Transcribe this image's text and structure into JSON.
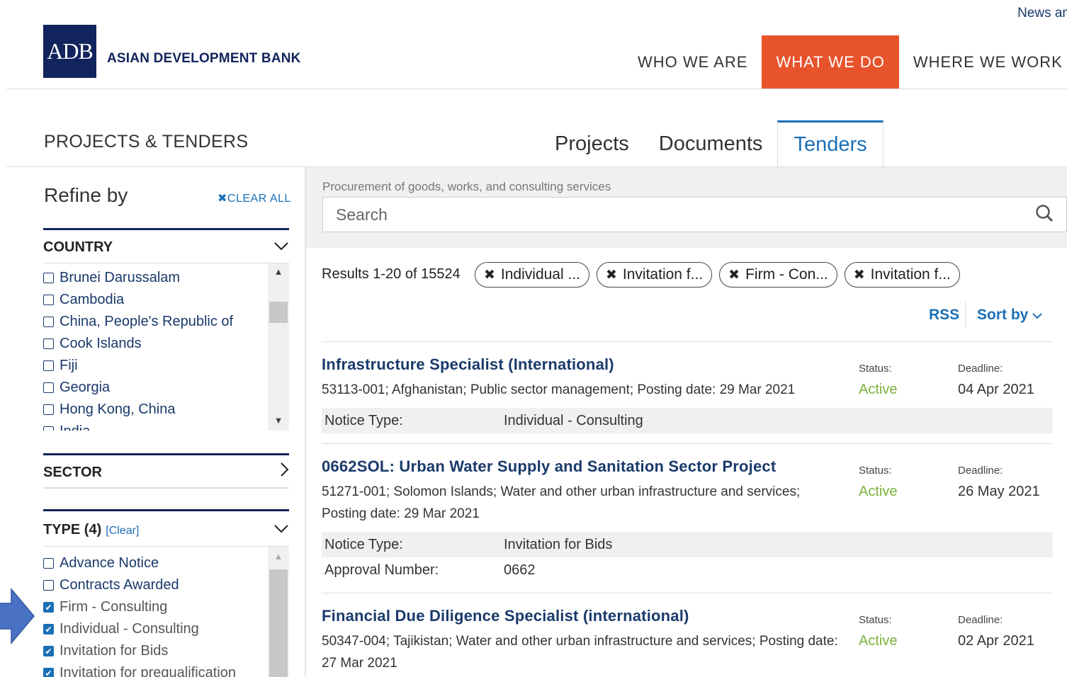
{
  "header": {
    "news_link": "News an",
    "logo_mark": "ADB",
    "logo_text": "ASIAN DEVELOPMENT BANK",
    "nav": [
      "WHO WE ARE",
      "WHAT WE DO",
      "WHERE WE WORK"
    ],
    "active_nav": "WHAT WE DO"
  },
  "section": {
    "title": "PROJECTS & TENDERS",
    "tabs": [
      "Projects",
      "Documents",
      "Tenders"
    ],
    "active_tab": "Tenders"
  },
  "sidebar": {
    "refine_label": "Refine by",
    "clear_all": "CLEAR ALL",
    "country": {
      "label": "COUNTRY",
      "items": [
        "Brunei Darussalam",
        "Cambodia",
        "China, People's Republic of",
        "Cook Islands",
        "Fiji",
        "Georgia",
        "Hong Kong, China",
        "India"
      ]
    },
    "sector": {
      "label": "SECTOR"
    },
    "type": {
      "label": "TYPE (4)",
      "clear": "[Clear]",
      "items": [
        {
          "label": "Advance Notice",
          "checked": false
        },
        {
          "label": "Contracts Awarded",
          "checked": false
        },
        {
          "label": "Firm - Consulting",
          "checked": true
        },
        {
          "label": "Individual - Consulting",
          "checked": true
        },
        {
          "label": "Invitation for Bids",
          "checked": true
        },
        {
          "label": "Invitation for prequalification",
          "checked": true
        }
      ]
    }
  },
  "search": {
    "caption": "Procurement of goods, works, and consulting services",
    "placeholder": "Search"
  },
  "results": {
    "count_text": "Results 1-20 of 15524",
    "chips": [
      "Individual ...",
      "Invitation f...",
      "Firm - Con...",
      "Invitation f..."
    ],
    "rss": "RSS",
    "sort_by": "Sort by",
    "status_label": "Status:",
    "deadline_label": "Deadline:",
    "items": [
      {
        "title": "Infrastructure Specialist (International)",
        "meta": "53113-001; Afghanistan; Public sector management; Posting date: 29 Mar 2021",
        "status": "Active",
        "deadline": "04 Apr 2021",
        "notice_type_label": "Notice Type:",
        "notice_type": "Individual - Consulting"
      },
      {
        "title": "0662SOL: Urban Water Supply and Sanitation Sector Project",
        "meta": "51271-001; Solomon Islands; Water and other urban infrastructure and services; Posting date: 29 Mar 2021",
        "status": "Active",
        "deadline": "26 May 2021",
        "notice_type_label": "Notice Type:",
        "notice_type": "Invitation for Bids",
        "approval_label": "Approval Number:",
        "approval": "0662"
      },
      {
        "title": "Financial Due Diligence Specialist (international)",
        "meta": "50347-004; Tajikistan; Water and other urban infrastructure and services; Posting date: 27 Mar 2021",
        "status": "Active",
        "deadline": "02 Apr 2021"
      }
    ]
  },
  "colors": {
    "brand": "#11245d",
    "accent": "#e7532b",
    "link": "#1a6fb5",
    "status_active": "#7bb33a",
    "pointer_arrow": "#4a72c4"
  }
}
